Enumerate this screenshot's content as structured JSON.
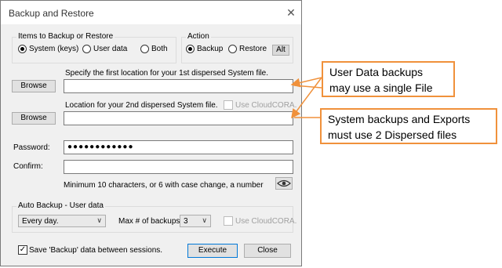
{
  "window": {
    "title": "Backup and Restore",
    "close_glyph": "✕"
  },
  "items_group": {
    "label": "Items to Backup or Restore",
    "options": [
      {
        "label": "System (keys)",
        "selected": true
      },
      {
        "label": "User data",
        "selected": false
      },
      {
        "label": "Both",
        "selected": false
      }
    ]
  },
  "action_group": {
    "label": "Action",
    "options": [
      {
        "label": "Backup",
        "selected": true
      },
      {
        "label": "Restore",
        "selected": false
      }
    ],
    "alt_label": "Alt"
  },
  "first_location": {
    "hint": "Specify the first location for your 1st dispersed System file.",
    "browse_label": "Browse",
    "value": ""
  },
  "second_location": {
    "hint": "Location for your 2nd dispersed System file.",
    "cloud_label": "Use CloudCORA.",
    "browse_label": "Browse",
    "value": ""
  },
  "password": {
    "label": "Password:",
    "value": "●●●●●●●●●●●●"
  },
  "confirm": {
    "label": "Confirm:",
    "value": ""
  },
  "password_hint": "Minimum 10 characters, or 6 with case change, a number",
  "auto_backup": {
    "label": "Auto Backup - User data",
    "frequency": "Every day.",
    "max_label": "Max # of backups:",
    "max_value": "3",
    "cloud_label": "Use CloudCORA."
  },
  "save_checkbox": {
    "label": "Save 'Backup' data between sessions.",
    "checked": true
  },
  "buttons": {
    "execute": "Execute",
    "close": "Close"
  },
  "callouts": [
    {
      "line1": "User Data backups",
      "line2": "may use a single File"
    },
    {
      "line1": "System backups and Exports",
      "line2": "must use 2 Dispersed files"
    }
  ],
  "colors": {
    "callout_border": "#f0913b",
    "arrow": "#f0913b",
    "execute_border": "#0078d7"
  },
  "icons": {
    "eye": "eye-icon",
    "chevron": "chevron-down-icon",
    "check": "checkmark-icon"
  }
}
